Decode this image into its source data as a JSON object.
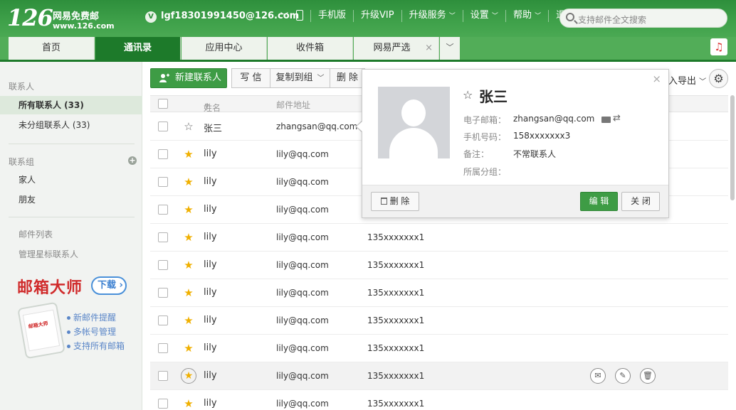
{
  "header": {
    "logo_number": "126",
    "logo_text": "网易免费邮",
    "logo_domain": "www.126.com",
    "user_badge": "V",
    "user_email": "lgf18301991450@126.com",
    "nav": [
      "手机版",
      "升级VIP",
      "升级服务",
      "设置",
      "帮助",
      "退出"
    ],
    "search_placeholder": "支持邮件全文搜索"
  },
  "tabs": [
    {
      "label": "首页",
      "active": false
    },
    {
      "label": "通讯录",
      "active": true
    },
    {
      "label": "应用中心",
      "active": false
    },
    {
      "label": "收件箱",
      "active": false
    },
    {
      "label": "网易严选",
      "active": false,
      "closable": true
    }
  ],
  "sidebar": {
    "contacts_title": "联系人",
    "contacts_items": [
      {
        "label": "所有联系人 (33)",
        "active": true
      },
      {
        "label": "未分组联系人 (33)",
        "active": false
      }
    ],
    "groups_title": "联系组",
    "groups": [
      "家人",
      "朋友"
    ],
    "links": [
      "邮件列表",
      "管理星标联系人"
    ],
    "promo": {
      "title": "邮箱大师",
      "download": "下载",
      "features": [
        "新邮件提醒",
        "多帐号管理",
        "支持所有邮箱"
      ],
      "phone_screen": "邮箱大师"
    }
  },
  "toolbar": {
    "new_contact": "新建联系人",
    "write": "写 信",
    "copy_to_group": "复制到组",
    "delete": "删 除",
    "import_export": "入导出"
  },
  "table": {
    "headers": {
      "name": "姓名",
      "sort_arrow": "↑",
      "email": "邮件地址"
    },
    "rows": [
      {
        "name": "张三",
        "email": "zhangsan@qq.com",
        "phone": "",
        "starred": false
      },
      {
        "name": "lily",
        "email": "lily@qq.com",
        "phone": "",
        "starred": true
      },
      {
        "name": "lily",
        "email": "lily@qq.com",
        "phone": "",
        "starred": true
      },
      {
        "name": "lily",
        "email": "lily@qq.com",
        "phone": "",
        "starred": true
      },
      {
        "name": "lily",
        "email": "lily@qq.com",
        "phone": "135xxxxxxx1",
        "starred": true
      },
      {
        "name": "lily",
        "email": "lily@qq.com",
        "phone": "135xxxxxxx1",
        "starred": true
      },
      {
        "name": "lily",
        "email": "lily@qq.com",
        "phone": "135xxxxxxx1",
        "starred": true
      },
      {
        "name": "lily",
        "email": "lily@qq.com",
        "phone": "135xxxxxxx1",
        "starred": true
      },
      {
        "name": "lily",
        "email": "lily@qq.com",
        "phone": "135xxxxxxx1",
        "starred": true
      },
      {
        "name": "lily",
        "email": "lily@qq.com",
        "phone": "135xxxxxxx1",
        "starred": true,
        "hover": true
      },
      {
        "name": "lily",
        "email": "lily@qq.com",
        "phone": "135xxxxxxx1",
        "starred": true
      }
    ]
  },
  "card": {
    "name": "张三",
    "email_label": "电子邮箱：",
    "email": "zhangsan@qq.com",
    "phone_label": "手机号码：",
    "phone": "158xxxxxxx3",
    "note_label": "备注：",
    "note": "不常联系人",
    "group_label": "所属分组：",
    "group": "",
    "delete": "删 除",
    "edit": "编 辑",
    "close": "关 闭"
  },
  "colors": {
    "brand_green": "#3e9c45",
    "header_green": "#2e8f3c",
    "star_gold": "#f0b000"
  },
  "icons": [
    "search-icon",
    "phone-icon",
    "gear-icon",
    "star-icon",
    "mail-icon",
    "edit-icon",
    "trash-icon",
    "close-icon",
    "music-icon",
    "user-plus-icon"
  ]
}
